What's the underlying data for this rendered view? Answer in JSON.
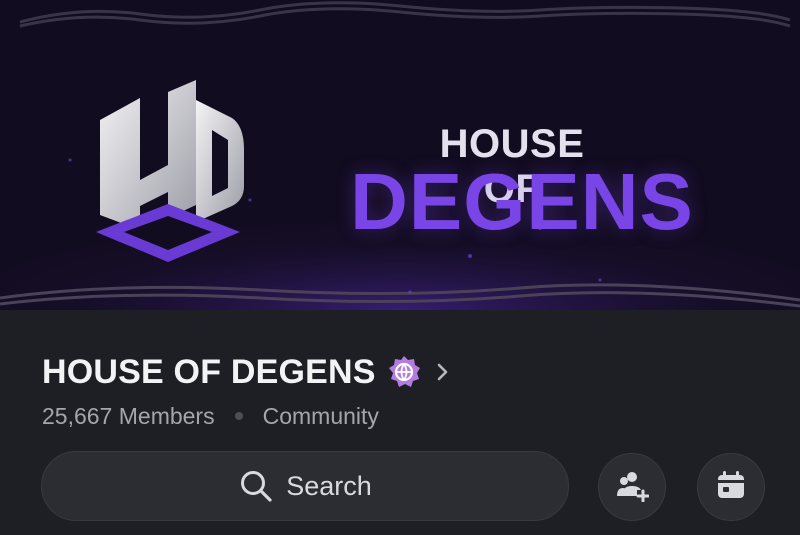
{
  "banner": {
    "logo_letters": "HD",
    "title_top": "HOUSE OF",
    "title_bottom": "DEGENS"
  },
  "server": {
    "name": "HOUSE OF DEGENS",
    "members": "25,667 Members",
    "type": "Community"
  },
  "search": {
    "label": "Search",
    "icon": "search-icon"
  },
  "actions": {
    "invite_icon": "add-member-icon",
    "events_icon": "calendar-icon"
  },
  "colors": {
    "background": "#1e1f24",
    "banner_bg": "#100b1c",
    "brand_purple": "#7a45e6",
    "badge_purple": "#b37ce0"
  }
}
